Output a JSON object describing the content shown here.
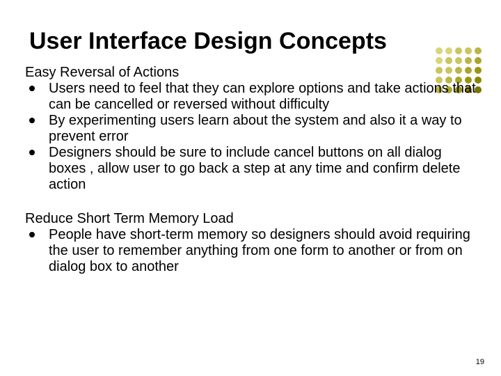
{
  "title": "User Interface Design Concepts",
  "section1": {
    "heading": "Easy Reversal of Actions",
    "bullets": [
      "Users need to feel that they can explore options and take actions that can be cancelled or reversed without difficulty",
      "By experimenting users learn about the system and also it a way to prevent error",
      "Designers should be sure to include cancel buttons on all dialog boxes , allow user to go back a step at any time and confirm delete action"
    ]
  },
  "section2": {
    "heading": "Reduce Short Term Memory Load",
    "bullets": [
      "People have short-term memory so designers should avoid requiring the user to remember anything from one form to another or from on dialog box to another"
    ]
  },
  "page_number": "19",
  "dot_colors": [
    "#d9d57a",
    "#d9d57a",
    "#c9c560",
    "#c9c560",
    "#b9b546",
    "#d9d57a",
    "#c9c560",
    "#c9c560",
    "#b9b546",
    "#a9a52c",
    "#c9c560",
    "#c9c560",
    "#b9b546",
    "#a9a52c",
    "#999512",
    "#c9c560",
    "#b9b546",
    "#a9a52c",
    "#999512",
    "#8a8600",
    "#b9b546",
    "#a9a52c",
    "#999512",
    "#8a8600",
    "#7a7600"
  ]
}
